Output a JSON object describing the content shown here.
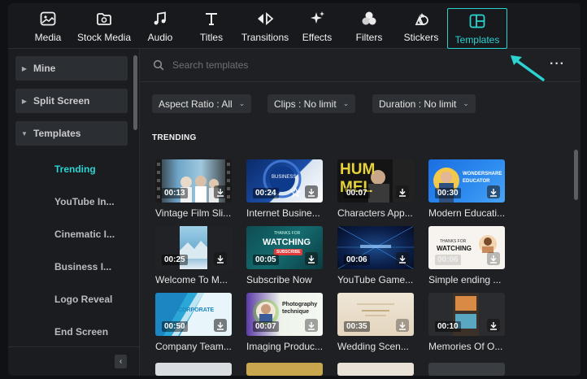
{
  "toolbar": {
    "items": [
      {
        "label": "Media",
        "icon": "media-icon"
      },
      {
        "label": "Stock Media",
        "icon": "stock-media-icon"
      },
      {
        "label": "Audio",
        "icon": "music-note-icon"
      },
      {
        "label": "Titles",
        "icon": "text-t-icon"
      },
      {
        "label": "Transitions",
        "icon": "transitions-icon"
      },
      {
        "label": "Effects",
        "icon": "sparkle-icon"
      },
      {
        "label": "Filters",
        "icon": "filters-icon"
      },
      {
        "label": "Stickers",
        "icon": "stickers-icon"
      },
      {
        "label": "Templates",
        "icon": "templates-icon",
        "active": true
      }
    ]
  },
  "sidebar": {
    "groups": [
      {
        "label": "Mine",
        "expanded": false
      },
      {
        "label": "Split Screen",
        "expanded": false
      },
      {
        "label": "Templates",
        "expanded": true
      }
    ],
    "subitems": [
      {
        "label": "Trending",
        "active": true
      },
      {
        "label": "YouTube In..."
      },
      {
        "label": "Cinematic I..."
      },
      {
        "label": "Business I..."
      },
      {
        "label": "Logo Reveal"
      },
      {
        "label": "End Screen"
      }
    ],
    "collapse_glyph": "‹"
  },
  "search": {
    "placeholder": "Search templates",
    "value": ""
  },
  "more_glyph": "···",
  "filters": [
    {
      "label": "Aspect Ratio : All"
    },
    {
      "label": "Clips : No limit"
    },
    {
      "label": "Duration : No limit"
    }
  ],
  "section_title": "TRENDING",
  "templates": [
    {
      "title": "Vintage Film Sli...",
      "duration": "00:13"
    },
    {
      "title": "Internet Busine...",
      "duration": "00:24",
      "starred": true
    },
    {
      "title": "Characters App...",
      "duration": "00:07",
      "thumb_text": "HUM MEL"
    },
    {
      "title": "Modern Educati...",
      "duration": "00:30",
      "thumb_text": "WONDERSHARE EDUCATOR"
    },
    {
      "title": "Welcome To M...",
      "duration": "00:25"
    },
    {
      "title": "Subscribe Now",
      "duration": "00:05",
      "thumb_text": "WATCHING",
      "thumb_pretext": "THANKS FOR",
      "thumb_sub": "SUBSCRIBE"
    },
    {
      "title": "YouTube Game...",
      "duration": "00:06"
    },
    {
      "title": "Simple ending ...",
      "duration": "00:06",
      "thumb_text": "WATCHING",
      "thumb_pretext": "THANKS FOR"
    },
    {
      "title": "Company Team...",
      "duration": "00:50",
      "thumb_text": "CORPORATE"
    },
    {
      "title": "Imaging Produc...",
      "duration": "00:07",
      "thumb_text": "Photography technique"
    },
    {
      "title": "Wedding Scen...",
      "duration": "00:35"
    },
    {
      "title": "Memories Of O...",
      "duration": "00:10"
    }
  ],
  "colors": {
    "accent": "#2bd3d1",
    "background": "#1e2024",
    "sidebar": "#1a1c1f"
  }
}
